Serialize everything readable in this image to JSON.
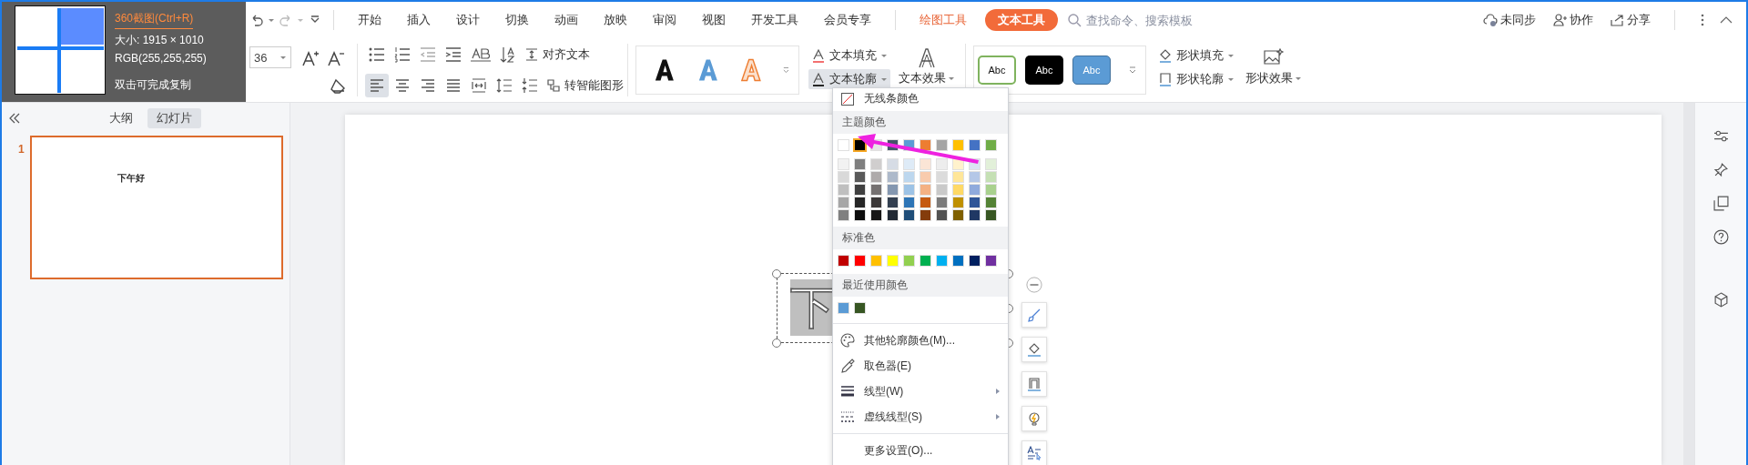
{
  "screenshot_tooltip": {
    "title": "360截图(Ctrl+R)",
    "size": "大小: 1915 × 1010",
    "rgb": "RGB(255,255,255)",
    "hint": "双击可完成复制"
  },
  "menu_tabs": [
    {
      "label": "开始",
      "selected": false
    },
    {
      "label": "插入",
      "selected": false
    },
    {
      "label": "设计",
      "selected": false
    },
    {
      "label": "切换",
      "selected": false
    },
    {
      "label": "动画",
      "selected": false
    },
    {
      "label": "放映",
      "selected": false
    },
    {
      "label": "审阅",
      "selected": false
    },
    {
      "label": "视图",
      "selected": false
    },
    {
      "label": "开发工具",
      "selected": false
    },
    {
      "label": "会员专享",
      "selected": false
    }
  ],
  "context_tabs": [
    {
      "label": "绘图工具",
      "selected": false
    },
    {
      "label": "文本工具",
      "selected": true
    }
  ],
  "search": {
    "placeholder": "查找命令、搜索模板"
  },
  "top_actions": [
    {
      "label": "未同步"
    },
    {
      "label": "协作"
    },
    {
      "label": "分享"
    }
  ],
  "ribbon": {
    "font_size": "36",
    "align_text": "对齐文本",
    "smart_art": "转智能图形",
    "text_fill": "文本填充",
    "text_outline": "文本轮廓",
    "text_outline_open": true,
    "text_effect": "文本效果",
    "shape_styles": [
      "Abc",
      "Abc",
      "Abc"
    ],
    "shape_fill": "形状填充",
    "shape_outline": "形状轮廓",
    "shape_effect": "形状效果"
  },
  "panel": {
    "tabs": [
      {
        "label": "大纲",
        "selected": false
      },
      {
        "label": "幻灯片",
        "selected": true
      }
    ],
    "slides": [
      {
        "number": "1",
        "title": "下午好",
        "selected": true
      }
    ]
  },
  "slide": {
    "text": "下"
  },
  "outline_menu": {
    "no_line": "无线条颜色",
    "theme_header": "主题颜色",
    "theme": [
      {
        "color": "#ffffff",
        "selected": false
      },
      {
        "color": "#000000",
        "selected": true
      },
      {
        "color": "#e7e6e6",
        "selected": false
      },
      {
        "color": "#44546a",
        "selected": false
      },
      {
        "color": "#5b9bd5",
        "selected": false
      },
      {
        "color": "#ed7d31",
        "selected": false
      },
      {
        "color": "#a5a5a5",
        "selected": false
      },
      {
        "color": "#ffc000",
        "selected": false
      },
      {
        "color": "#4472c4",
        "selected": false
      },
      {
        "color": "#70ad47",
        "selected": false
      }
    ],
    "shades": [
      [
        {
          "color": "#f2f2f2"
        },
        {
          "color": "#7f7f7f"
        },
        {
          "color": "#d0cece"
        },
        {
          "color": "#d6dce5"
        },
        {
          "color": "#deebf7"
        },
        {
          "color": "#fbe5d6"
        },
        {
          "color": "#ededed"
        },
        {
          "color": "#fff2cc"
        },
        {
          "color": "#dae3f3"
        },
        {
          "color": "#e2f0d9"
        }
      ],
      [
        {
          "color": "#d9d9d9"
        },
        {
          "color": "#595959"
        },
        {
          "color": "#aeaaaa"
        },
        {
          "color": "#adb9ca"
        },
        {
          "color": "#bdd7ee"
        },
        {
          "color": "#f8cbad"
        },
        {
          "color": "#dbdbdb"
        },
        {
          "color": "#ffe699"
        },
        {
          "color": "#b4c7e7"
        },
        {
          "color": "#c5e0b4"
        }
      ],
      [
        {
          "color": "#bfbfbf"
        },
        {
          "color": "#404040"
        },
        {
          "color": "#757171"
        },
        {
          "color": "#8497b0"
        },
        {
          "color": "#9dc3e6"
        },
        {
          "color": "#f4b183"
        },
        {
          "color": "#c9c9c9"
        },
        {
          "color": "#ffd966"
        },
        {
          "color": "#8faadc"
        },
        {
          "color": "#a9d18e"
        }
      ],
      [
        {
          "color": "#a6a6a6"
        },
        {
          "color": "#262626"
        },
        {
          "color": "#3b3838"
        },
        {
          "color": "#333f50"
        },
        {
          "color": "#2e75b6"
        },
        {
          "color": "#c55a11"
        },
        {
          "color": "#7b7b7b"
        },
        {
          "color": "#bf9000"
        },
        {
          "color": "#2f5597"
        },
        {
          "color": "#548235"
        }
      ],
      [
        {
          "color": "#808080"
        },
        {
          "color": "#0d0d0d"
        },
        {
          "color": "#171616"
        },
        {
          "color": "#222a35"
        },
        {
          "color": "#1f4e79"
        },
        {
          "color": "#843c0c"
        },
        {
          "color": "#525252"
        },
        {
          "color": "#7f6000"
        },
        {
          "color": "#203864"
        },
        {
          "color": "#385723"
        }
      ]
    ],
    "standard_header": "标准色",
    "standard": [
      {
        "color": "#c00000"
      },
      {
        "color": "#ff0000"
      },
      {
        "color": "#ffc000"
      },
      {
        "color": "#ffff00"
      },
      {
        "color": "#92d050"
      },
      {
        "color": "#00b050"
      },
      {
        "color": "#00b0f0"
      },
      {
        "color": "#0070c0"
      },
      {
        "color": "#002060"
      },
      {
        "color": "#7030a0"
      }
    ],
    "recent_header": "最近使用颜色",
    "recent": [
      {
        "color": "#5b9bd5"
      },
      {
        "color": "#375623"
      }
    ],
    "items": [
      {
        "kind": "palette",
        "label": "其他轮廓颜色(M)..."
      },
      {
        "kind": "picker",
        "label": "取色器(E)"
      },
      {
        "kind": "weight",
        "label": "线型(W)",
        "submenu": true
      },
      {
        "kind": "dash",
        "label": "虚线线型(S)",
        "submenu": true
      },
      {
        "kind": "more",
        "label": "更多设置(O)..."
      }
    ]
  }
}
